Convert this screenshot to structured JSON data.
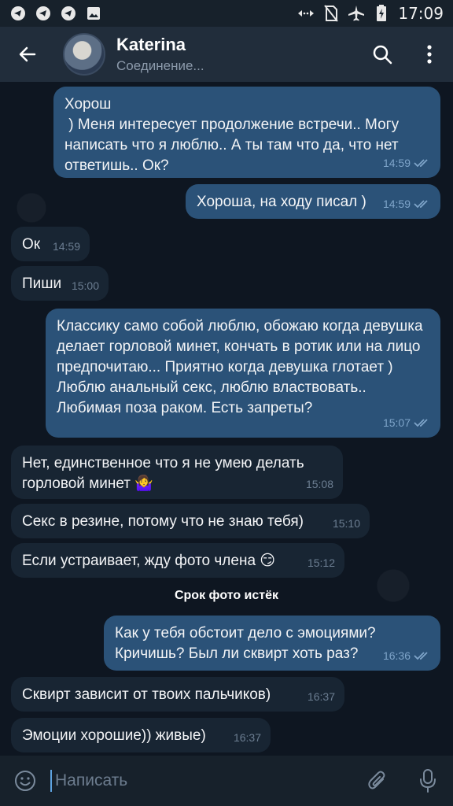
{
  "status_bar": {
    "time": "17:09"
  },
  "header": {
    "title": "Katerina",
    "status": "Соединение..."
  },
  "messages": [
    {
      "dir": "out",
      "text": "Хорош\n ) Меня интересует продолжение встречи.. Могу написать что я люблю.. А ты там что да, что нет ответишь.. Ок?",
      "time": "14:59",
      "read": true
    },
    {
      "dir": "out",
      "text": "Хороша, на ходу писал )",
      "time": "14:59",
      "read": true
    },
    {
      "dir": "in",
      "text": "Ок",
      "time": "14:59"
    },
    {
      "dir": "in",
      "text": "Пиши",
      "time": "15:00"
    },
    {
      "dir": "out",
      "text": "Классику само собой люблю, обожаю когда девушка делает горловой минет, кончать в ротик или на лицо предпочитаю... Приятно когда девушка глотает ) Люблю анальный секс, люблю властвовать.. Любимая поза раком. Есть запреты?",
      "time": "15:07",
      "read": true
    },
    {
      "dir": "in",
      "text": "Нет, единственное что я не умею делать горловой минет 🤷‍♀️",
      "time": "15:08"
    },
    {
      "dir": "in",
      "text": "Секс в резине, потому что не знаю тебя)",
      "time": "15:10"
    },
    {
      "dir": "in",
      "text": "Если устраивает, жду фото члена 😏",
      "time": "15:12"
    },
    {
      "dir": "service",
      "text": "Срок фото истёк"
    },
    {
      "dir": "out",
      "text": "Как у тебя обстоит дело с эмоциями? Кричишь? Был ли сквирт хоть раз?",
      "time": "16:36",
      "read": true
    },
    {
      "dir": "in",
      "text": "Сквирт зависит от твоих пальчиков)",
      "time": "16:37"
    },
    {
      "dir": "in",
      "text": "Эмоции хорошие)) живые)",
      "time": "16:37"
    }
  ],
  "composer": {
    "placeholder": "Написать"
  },
  "icons": {
    "back": "arrow-left-icon",
    "search": "search-icon",
    "menu": "more-vertical-icon",
    "emoji": "smile-icon",
    "attach": "paperclip-icon",
    "mic": "microphone-icon"
  },
  "colors": {
    "bubble_out": "#2b5278",
    "bubble_in": "#182533",
    "header": "#212d3b",
    "background": "#0e1621"
  }
}
